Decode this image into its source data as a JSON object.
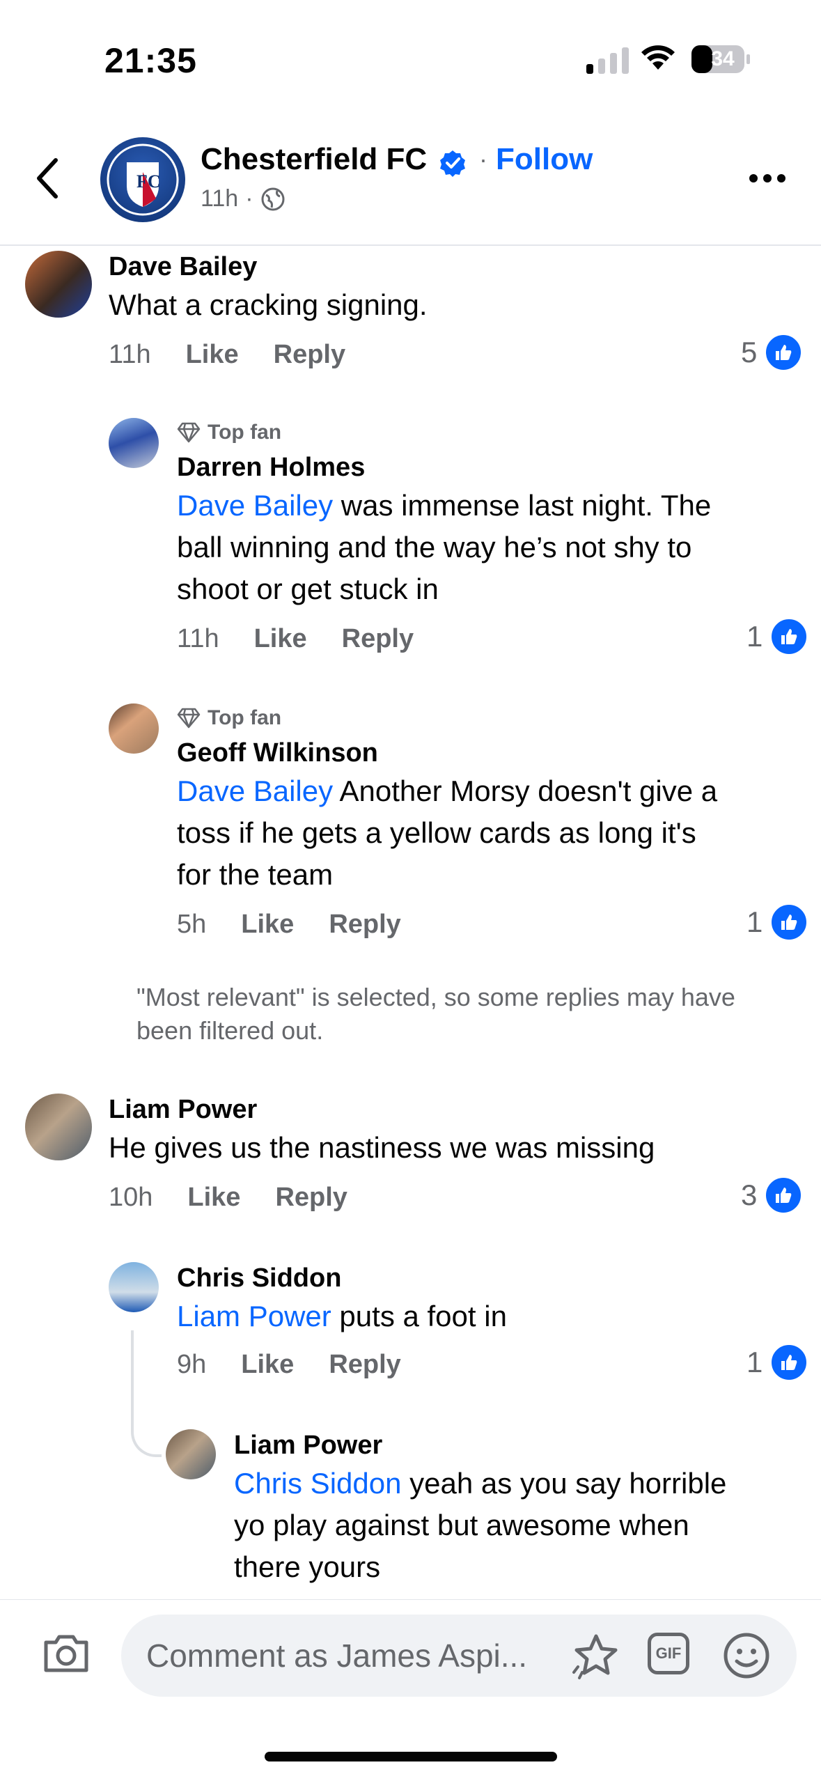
{
  "status_bar": {
    "time": "21:35",
    "battery": "34"
  },
  "header": {
    "page_name": "Chesterfield FC",
    "separator": "·",
    "follow": "Follow",
    "time": "11h",
    "meta_sep": "·"
  },
  "comments": [
    {
      "name": "Dave Bailey",
      "text": "What a cracking signing.",
      "time": "11h",
      "like": "Like",
      "reply": "Reply",
      "likes": "5"
    },
    {
      "badge": "Top fan",
      "name": "Darren Holmes",
      "mention": "Dave Bailey",
      "text_line1": " was immense last night. The",
      "text_line2": "ball winning and the way he’s not shy to",
      "text_line3": "shoot or get stuck in",
      "time": "11h",
      "like": "Like",
      "reply": "Reply",
      "likes": "1"
    },
    {
      "badge": "Top fan",
      "name": "Geoff Wilkinson",
      "mention": "Dave Bailey",
      "text_line1": " Another Morsy doesn't give a",
      "text_line2": "toss if he gets a yellow cards as long it's",
      "text_line3": "for the team",
      "time": "5h",
      "like": "Like",
      "reply": "Reply",
      "likes": "1"
    },
    {
      "name": "Liam Power",
      "text": "He gives us the nastiness we was missing",
      "time": "10h",
      "like": "Like",
      "reply": "Reply",
      "likes": "3"
    },
    {
      "name": "Chris Siddon",
      "mention": "Liam Power",
      "text": " puts a foot in",
      "time": "9h",
      "like": "Like",
      "reply": "Reply",
      "likes": "1"
    },
    {
      "name": "Liam Power",
      "mention": "Chris Siddon",
      "text_line1": " yeah as you say horrible",
      "text_line2": "yo play against but awesome when",
      "text_line3": "there yours"
    }
  ],
  "notice": "\"Most relevant\" is selected, so some replies may have been filtered out.",
  "composer": {
    "placeholder": "Comment as James Aspi...",
    "gif": "GIF"
  },
  "icons": {
    "back": "chevron-left-icon",
    "verified": "verified-badge-icon",
    "globe": "globe-icon",
    "more": "more-icon",
    "like": "thumbs-up-icon",
    "diamond": "diamond-icon",
    "camera": "camera-icon",
    "sticker": "sticker-icon",
    "emoji": "emoji-icon"
  },
  "colors": {
    "accent": "#0866ff",
    "muted": "#65676b",
    "text": "#050505"
  }
}
